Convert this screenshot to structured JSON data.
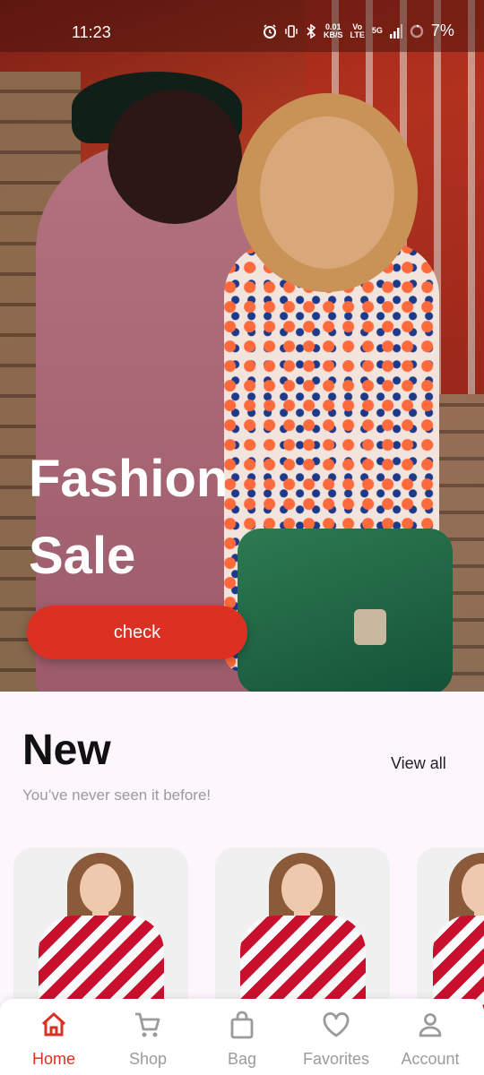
{
  "status_bar": {
    "time": "11:23",
    "net_speed_value": "0.01",
    "net_speed_unit": "KB/S",
    "volte_top": "Vo",
    "volte_bottom": "LTE",
    "network": "5G",
    "battery": "7%",
    "icons": [
      "alarm-icon",
      "vibrate-icon",
      "bluetooth-icon",
      "volte-icon",
      "signal-icon",
      "battery-icon"
    ]
  },
  "hero": {
    "title": "Fashion Sale",
    "button_label": "check"
  },
  "new_section": {
    "title": "New",
    "subtitle": "You’ve never seen it before!",
    "view_all_label": "View all"
  },
  "bottom_nav": {
    "items": [
      {
        "label": "Home",
        "icon": "home-icon",
        "active": true
      },
      {
        "label": "Shop",
        "icon": "cart-icon",
        "active": false
      },
      {
        "label": "Bag",
        "icon": "bag-icon",
        "active": false
      },
      {
        "label": "Favorites",
        "icon": "heart-icon",
        "active": false
      },
      {
        "label": "Account",
        "icon": "person-icon",
        "active": false
      }
    ]
  },
  "colors": {
    "accent": "#db3022",
    "background": "#fdf6fc",
    "muted_text": "#9b9b9b"
  }
}
